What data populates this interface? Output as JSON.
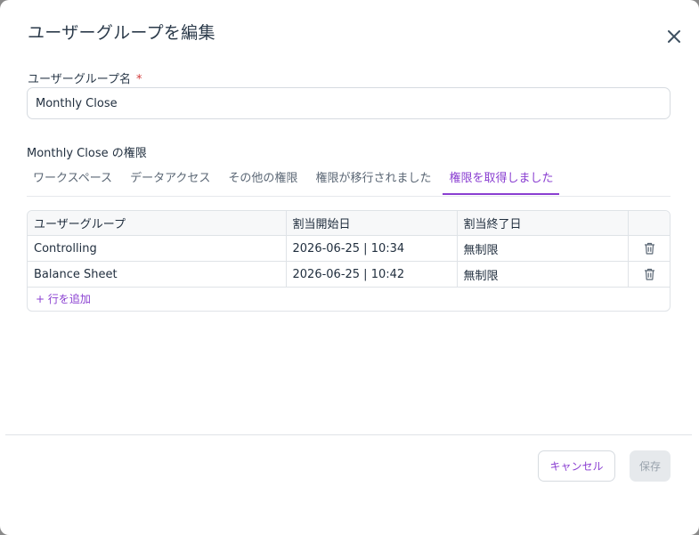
{
  "dialog": {
    "title": "ユーザーグループを編集",
    "close_icon": "close-icon"
  },
  "form": {
    "name_label": "ユーザーグループ名",
    "required_mark": "*",
    "name_value": "Monthly Close"
  },
  "permissions": {
    "heading": "Monthly Close の権限",
    "tabs": [
      {
        "label": "ワークスペース",
        "active": false
      },
      {
        "label": "データアクセス",
        "active": false
      },
      {
        "label": "その他の権限",
        "active": false
      },
      {
        "label": "権限が移行されました",
        "active": false
      },
      {
        "label": "権限を取得しました",
        "active": true
      }
    ],
    "accent_color": "#8a3fd1"
  },
  "table": {
    "columns": [
      "ユーザーグループ",
      "割当開始日",
      "割当終了日",
      ""
    ],
    "rows": [
      {
        "group": "Controlling",
        "start": "2026-06-25 | 10:34",
        "end": "無制限",
        "action_icon": "trash-icon"
      },
      {
        "group": "Balance Sheet",
        "start": "2026-06-25 | 10:42",
        "end": "無制限",
        "action_icon": "trash-icon"
      }
    ],
    "add_row_label": "+ 行を追加"
  },
  "footer": {
    "cancel_label": "キャンセル",
    "save_label": "保存"
  }
}
